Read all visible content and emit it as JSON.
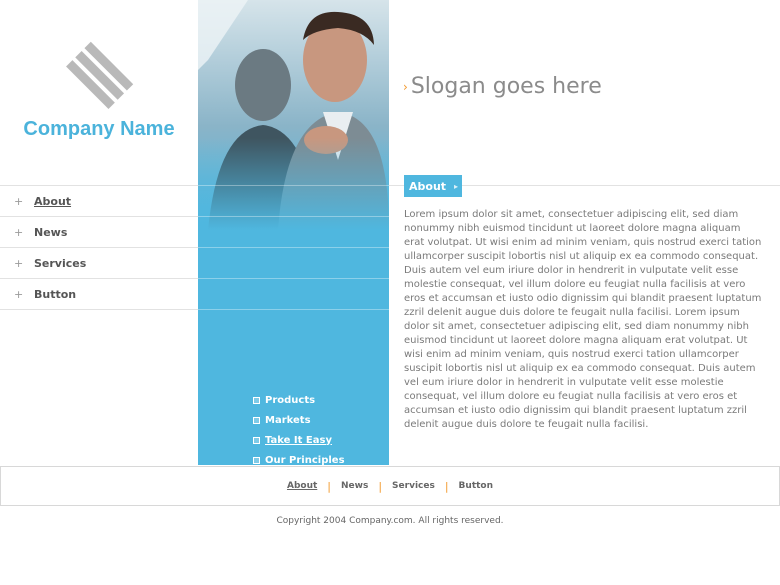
{
  "brand": {
    "company_name": "Company Name",
    "logo_icon": "diamond-stripes-logo",
    "accent_color": "#4fb7df",
    "orange": "#f29a2e"
  },
  "left_nav": {
    "items": [
      {
        "label": "About"
      },
      {
        "label": "News"
      },
      {
        "label": "Services"
      },
      {
        "label": "Button"
      }
    ]
  },
  "middle_links": {
    "items": [
      {
        "label": "Products"
      },
      {
        "label": "Markets"
      },
      {
        "label": "Take It Easy"
      },
      {
        "label": "Our Principles"
      }
    ]
  },
  "header": {
    "slogan": "Slogan goes here"
  },
  "content": {
    "section_title": "About",
    "body": "Lorem ipsum dolor sit amet, consectetuer adipiscing elit, sed diam nonummy nibh euismod tincidunt ut laoreet dolore magna aliquam erat volutpat. Ut wisi enim ad minim veniam, quis nostrud exerci tation ullamcorper suscipit lobortis nisl ut aliquip ex ea commodo consequat. Duis autem vel eum iriure dolor in hendrerit in vulputate velit esse molestie consequat, vel illum dolore eu feugiat nulla facilisis at vero eros et accumsan et iusto odio dignissim qui blandit praesent luptatum zzril delenit augue duis dolore te feugait nulla facilisi. Lorem ipsum dolor sit amet, consectetuer adipiscing elit, sed diam nonummy nibh euismod tincidunt ut laoreet dolore magna aliquam erat volutpat. Ut wisi enim ad minim veniam, quis nostrud exerci tation ullamcorper suscipit lobortis nisl ut aliquip ex ea commodo consequat. Duis autem vel eum iriure dolor in hendrerit in vulputate velit esse molestie consequat, vel illum dolore eu feugiat nulla facilisis at vero eros et accumsan et iusto odio dignissim qui blandit praesent luptatum zzril delenit augue duis dolore te feugait nulla facilisi."
  },
  "footer": {
    "nav": [
      {
        "label": "About"
      },
      {
        "label": "News"
      },
      {
        "label": "Services"
      },
      {
        "label": "Button"
      }
    ],
    "copyright": "Copyright 2004 Company.com. All rights reserved."
  }
}
